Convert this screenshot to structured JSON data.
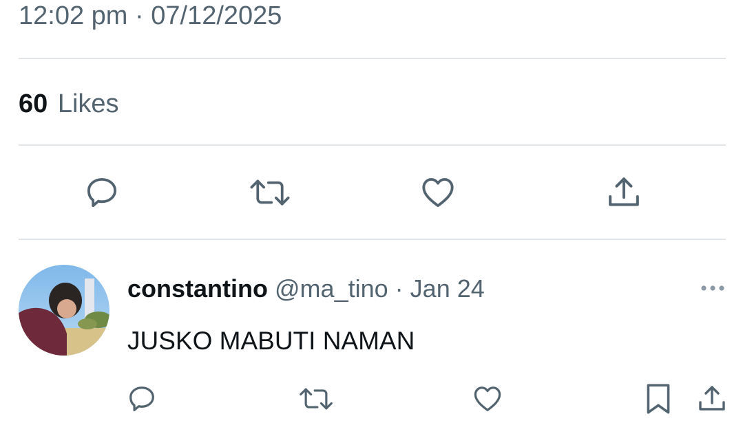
{
  "tweet": {
    "time": "12:02 pm",
    "separator": "·",
    "date": "07/12/2025",
    "likes_count": "60",
    "likes_label": "Likes",
    "actions": [
      "reply-icon",
      "retweet-icon",
      "like-icon",
      "share-icon"
    ]
  },
  "reply": {
    "display_name": "constantino",
    "handle": "@ma_tino",
    "separator": "·",
    "date": "Jan 24",
    "text": "JUSKO MABUTI NAMAN",
    "more_icon": "more-icon",
    "actions": [
      "reply-icon",
      "retweet-icon",
      "like-icon",
      "bookmark-icon",
      "share-icon"
    ]
  },
  "colors": {
    "text_primary": "#0f1419",
    "text_secondary": "#536471",
    "icon": "#536471",
    "divider": "#e1e5e8"
  }
}
